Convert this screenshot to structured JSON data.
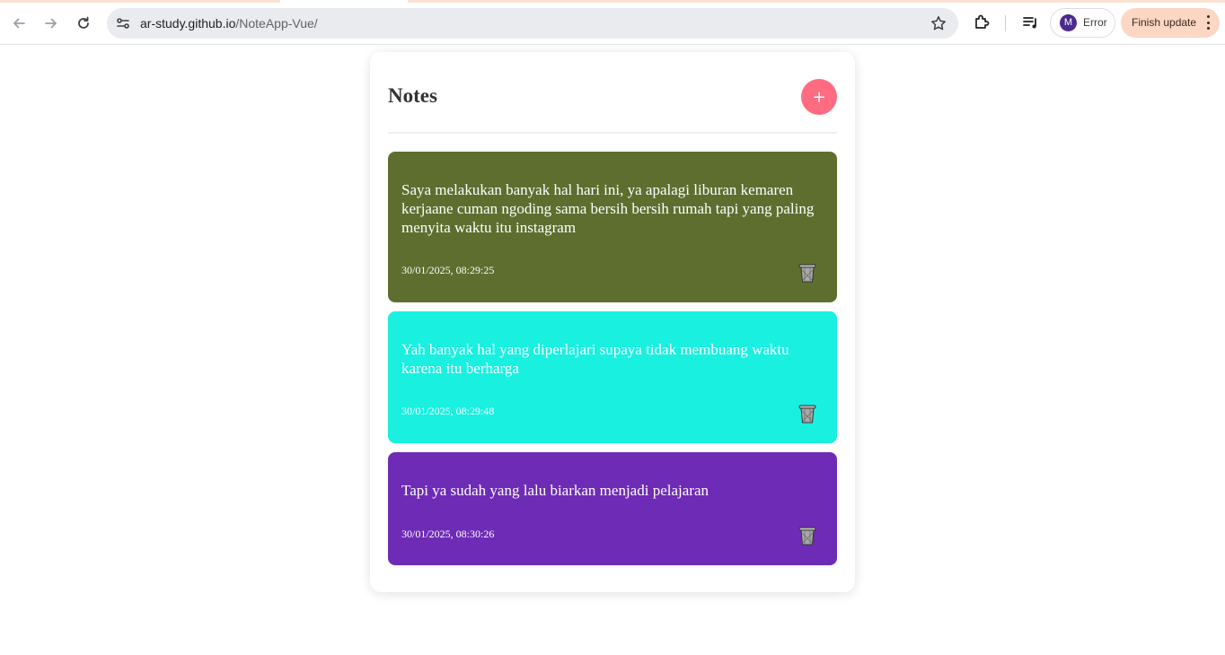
{
  "browser": {
    "url_host": "ar-study.github.io",
    "url_path": "/NoteApp-Vue/",
    "profile_initial": "M",
    "profile_label": "Error",
    "update_label": "Finish update"
  },
  "app": {
    "title": "Notes",
    "add_label": "+"
  },
  "notes": [
    {
      "text": "Saya melakukan banyak hal hari ini, ya apalagi liburan kemaren kerjaane cuman ngoding sama bersih bersih rumah tapi yang paling menyita waktu itu instagram",
      "date": "30/01/2025, 08:29:25",
      "color": "#5d6e2f"
    },
    {
      "text": "Yah banyak hal yang diperlajari supaya tidak membuang waktu karena itu berharga",
      "date": "30/01/2025, 08:29:48",
      "color": "#19f0e0"
    },
    {
      "text": "Tapi ya sudah yang lalu biarkan menjadi pelajaran",
      "date": "30/01/2025, 08:30:26",
      "color": "#6e2bb5"
    }
  ],
  "colors": {
    "add_button": "#ff6b81",
    "title_text": "#333333",
    "update_chip": "#fbd7c4"
  },
  "icons": [
    "back-icon",
    "forward-icon",
    "reload-icon",
    "site-info-icon",
    "bookmark-star-icon",
    "extensions-icon",
    "media-controls-icon",
    "more-vert-icon",
    "trash-icon"
  ]
}
